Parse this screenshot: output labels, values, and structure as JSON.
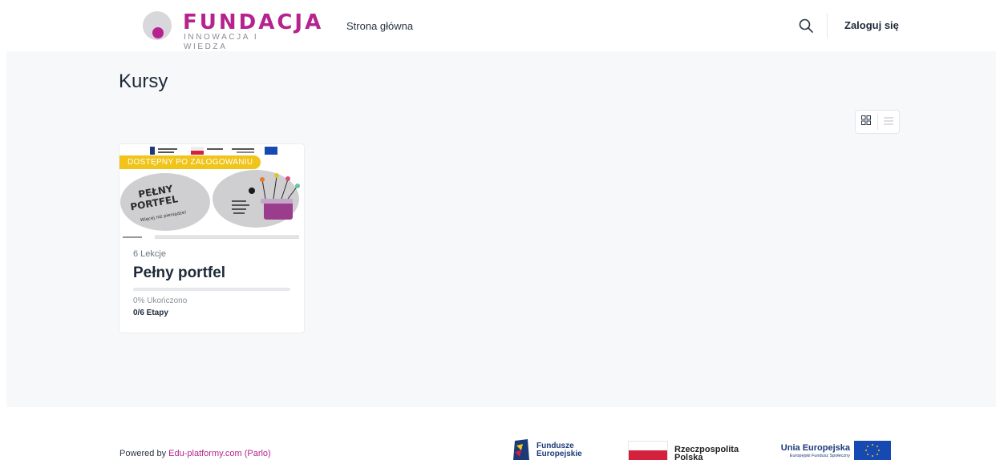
{
  "header": {
    "logo_title": "FUNDACJA",
    "logo_subtitle": "INNOWACJA I WIEDZA",
    "nav_home": "Strona główna",
    "login": "Zaloguj się",
    "search_icon": "search-icon"
  },
  "main": {
    "page_title": "Kursy",
    "view_toggle": [
      "grid-icon",
      "list-icon"
    ],
    "courses": [
      {
        "badge": "DOSTĘPNY PO ZALOGOWANIU",
        "lessons": "6 Lekcje",
        "title": "Pełny portfel",
        "progress_percent": 0,
        "completed": "0% Ukończono",
        "stages": "0/6 Etapy",
        "thumb_title": "PEŁNY PORTFEL",
        "thumb_tagline": "Więcej niż pieniądze!"
      }
    ]
  },
  "footer": {
    "powered_prefix": "Powered by ",
    "powered_link": "Edu-platformy.com (Parlo)",
    "fe_line1": "Fundusze",
    "fe_line2": "Europejskie",
    "rp_line1": "Rzeczpospolita",
    "rp_line2": "Polska",
    "ue_line1": "Unia Europejska",
    "ue_line2": "Europejski Fundusz Społeczny"
  },
  "colors": {
    "brand": "#b5238f",
    "badge": "#f0c419",
    "background": "#f7f8fa"
  }
}
